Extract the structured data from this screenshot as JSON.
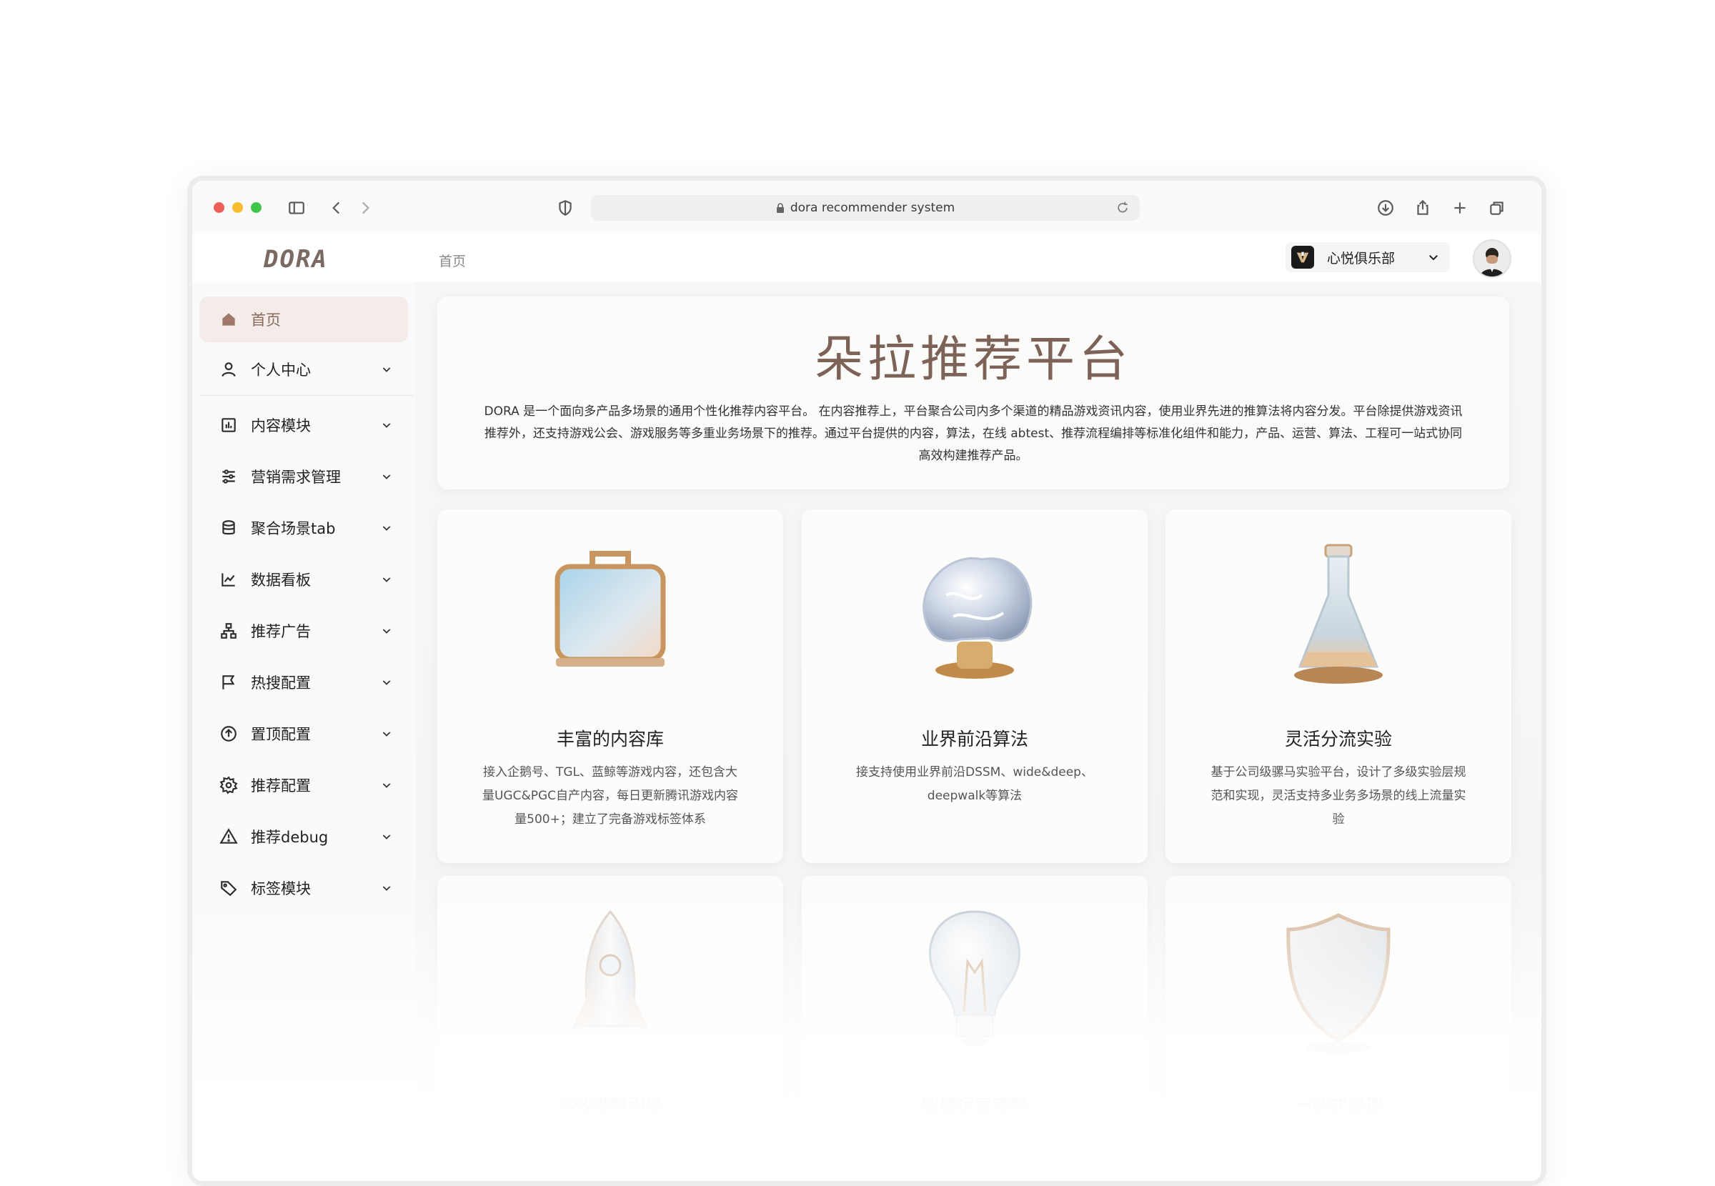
{
  "browser": {
    "url": "dora recommender system"
  },
  "app": {
    "logo": "DORA",
    "breadcrumb": "首页",
    "org_name": "心悦俱乐部"
  },
  "sidebar": {
    "items": [
      {
        "label": "首页",
        "icon": "home-icon",
        "active": true
      },
      {
        "label": "个人中心",
        "icon": "user-icon"
      },
      {
        "label": "内容模块",
        "icon": "chart-box-icon"
      },
      {
        "label": "营销需求管理",
        "icon": "sliders-icon"
      },
      {
        "label": "聚合场景tab",
        "icon": "database-icon"
      },
      {
        "label": "数据看板",
        "icon": "line-chart-icon"
      },
      {
        "label": "推荐广告",
        "icon": "org-tree-icon"
      },
      {
        "label": "热搜配置",
        "icon": "flag-icon"
      },
      {
        "label": "置顶配置",
        "icon": "arrow-up-circle-icon"
      },
      {
        "label": "推荐配置",
        "icon": "gear-icon"
      },
      {
        "label": "推荐debug",
        "icon": "warning-icon"
      },
      {
        "label": "标签模块",
        "icon": "tag-icon"
      }
    ]
  },
  "hero": {
    "title": "朵拉推荐平台",
    "description": "DORA 是一个面向多产品多场景的通用个性化推荐内容平台。 在内容推荐上，平台聚合公司内多个渠道的精品游戏资讯内容，使用业界先进的推算法将内容分发。平台除提供游戏资讯推荐外，还支持游戏公会、游戏服务等多重业务场景下的推荐。通过平台提供的内容，算法，在线 abtest、推荐流程编排等标准化组件和能力，产品、运营、算法、工程可一站式协同高效构建推荐产品。"
  },
  "cards": [
    {
      "title": "丰富的内容库",
      "desc": "接入企鹅号、TGL、蓝鲸等游戏内容，还包含大量UGC&PGC自产内容，每日更新腾讯游戏内容量500+；建立了完备游戏标签体系",
      "icon": "briefcase-icon"
    },
    {
      "title": "业界前沿算法",
      "desc": "接支持使用业界前沿DSSM、wide&deep、deepwalk等算法",
      "icon": "brain-icon"
    },
    {
      "title": "灵活分流实验",
      "desc": "基于公司级骡马实验平台，设计了多级实验层规范和实现，灵活支持多业务多场景的线上流量实验",
      "icon": "flask-icon"
    },
    {
      "title": "高效推荐引擎",
      "desc": "",
      "icon": "rocket-icon"
    },
    {
      "title": "敏捷运营策略",
      "desc": "",
      "icon": "lightbulb-icon"
    },
    {
      "title": "一站式管理",
      "desc": "",
      "icon": "shield-icon"
    }
  ],
  "colors": {
    "accent": "#8a6a5a",
    "active_bg": "#f3ece8"
  }
}
